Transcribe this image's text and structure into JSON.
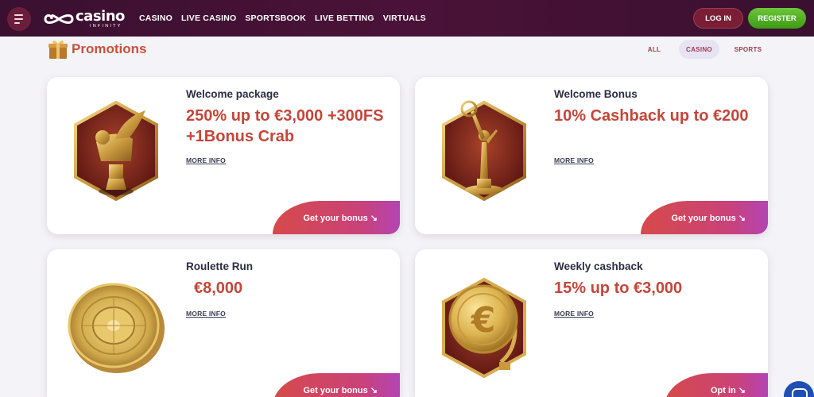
{
  "header": {
    "logo_main": "casino",
    "logo_sub": "INFINITY",
    "nav": [
      "CASINO",
      "LIVE CASINO",
      "SPORTSBOOK",
      "LIVE BETTING",
      "VIRTUALS"
    ],
    "login_label": "LOG IN",
    "register_label": "REGISTER"
  },
  "promotions": {
    "title": "Promotions",
    "filters": [
      "ALL",
      "CASINO",
      "SPORTS"
    ],
    "active_filter": "CASINO"
  },
  "cards": [
    {
      "title": "Welcome package",
      "offer": "250% up to €3,000 +300FS +1Bonus Crab",
      "more": "MORE INFO",
      "cta": "Get your bonus ↘",
      "icon": "winged-lion-statue-icon"
    },
    {
      "title": "Welcome Bonus",
      "offer": "10% Cashback up to €200",
      "more": "MORE INFO",
      "cta": "Get your bonus ↘",
      "icon": "trophy-statue-icon"
    },
    {
      "title": "Roulette Run",
      "offer": "€8,000",
      "more": "MORE INFO",
      "cta": "Get your bonus ↘",
      "icon": "roulette-wheel-icon"
    },
    {
      "title": "Weekly cashback",
      "offer": "15% up to €3,000",
      "more": "MORE INFO",
      "cta": "Opt in ↘",
      "icon": "euro-coin-icon"
    }
  ],
  "colors": {
    "header_bg": "#3a1030",
    "accent_red": "#c3463a",
    "register_green": "#4fae22",
    "login_bg": "#7a1e36"
  }
}
